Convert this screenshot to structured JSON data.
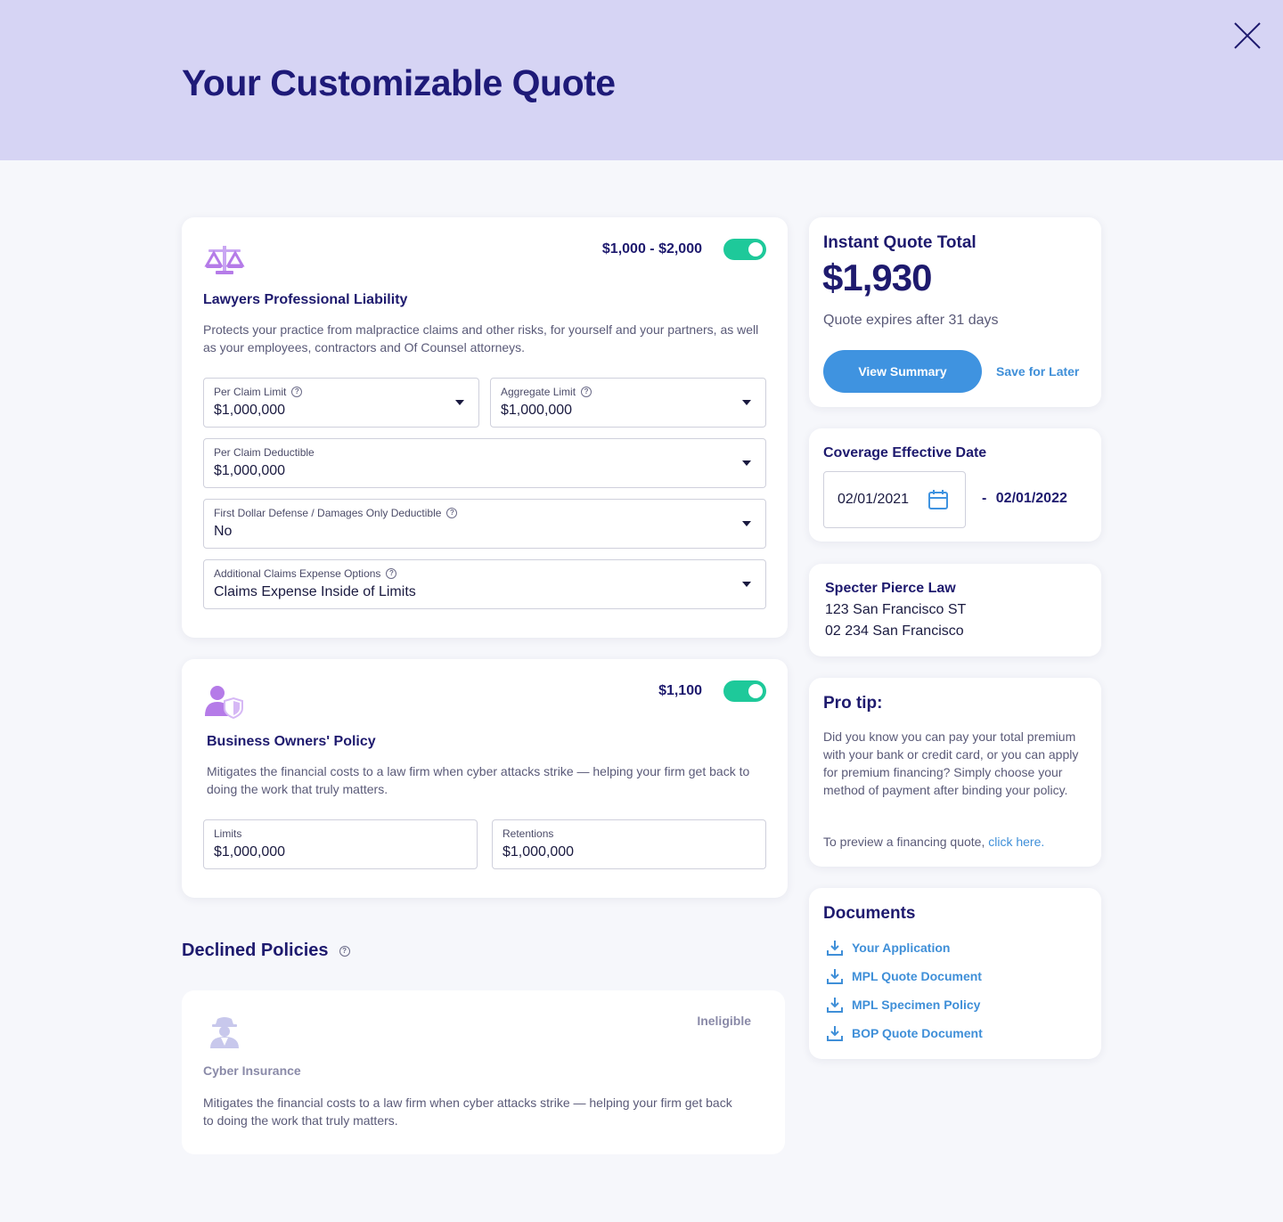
{
  "header": {
    "title": "Your Customizable Quote"
  },
  "lpl": {
    "title": "Lawyers Professional Liability",
    "price": "$1,000 - $2,000",
    "description": "Protects your practice from malpractice claims and other risks, for yourself and your partners, as well as your employees, contractors and Of Counsel attorneys.",
    "per_claim_limit": {
      "label": "Per Claim Limit",
      "value": "$1,000,000"
    },
    "aggregate_limit": {
      "label": "Aggregate Limit",
      "value": "$1,000,000"
    },
    "per_claim_deductible": {
      "label": "Per Claim Deductible",
      "value": "$1,000,000"
    },
    "first_dollar": {
      "label": "First Dollar Defense / Damages Only Deductible",
      "value": "No"
    },
    "claims_expense": {
      "label": "Additional Claims Expense Options",
      "value": "Claims Expense Inside of Limits"
    },
    "enabled": true
  },
  "bop": {
    "title": "Business Owners' Policy",
    "price": "$1,100",
    "description": "Mitigates the financial costs to a law firm when cyber attacks strike — helping your firm get back to doing the work that truly matters.",
    "limits": {
      "label": "Limits",
      "value": "$1,000,000"
    },
    "retentions": {
      "label": "Retentions",
      "value": "$1,000,000"
    },
    "enabled": true
  },
  "declined": {
    "heading": "Declined Policies",
    "cyber": {
      "title": "Cyber Insurance",
      "status": "Ineligible",
      "description": "Mitigates the financial costs to a law firm when cyber attacks strike — helping your firm get back to doing the work that truly matters."
    }
  },
  "quote": {
    "heading": "Instant Quote Total",
    "total": "$1,930",
    "expires": "Quote expires after 31 days",
    "view_summary": "View Summary",
    "save_later": "Save for Later"
  },
  "coverage": {
    "heading": "Coverage Effective Date",
    "start": "02/01/2021",
    "end_prefix": "-",
    "end": "02/01/2022"
  },
  "firm": {
    "name": "Specter Pierce Law",
    "address1": "123 San Francisco ST",
    "address2": "02 234 San Francisco"
  },
  "protip": {
    "heading": "Pro tip:",
    "body": "Did you know you can pay your total premium with your bank or credit card, or you can apply for premium financing? Simply choose your method of payment after binding your policy.",
    "preview_text": "To preview a financing quote,",
    "preview_link": "click here."
  },
  "documents": {
    "heading": "Documents",
    "items": [
      "Your Application",
      "MPL Quote Document",
      "MPL Specimen Policy",
      "BOP Quote Document"
    ]
  },
  "colors": {
    "header_bg": "#d6d4f4",
    "title": "#1e1a78",
    "toggle_on": "#1ec99a",
    "primary_button": "#3f93e0",
    "link": "#3f8fd8",
    "icon_purple": "#b57be8"
  }
}
